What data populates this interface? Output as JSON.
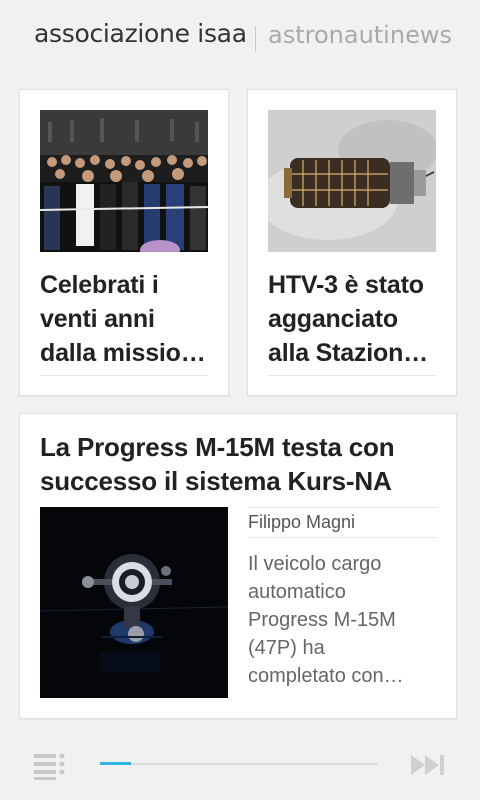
{
  "header": {
    "active_tab": "associazione isaa",
    "inactive_tab": "astronautinews"
  },
  "cards": [
    {
      "title_lines": [
        "Celebrati i",
        "venti anni",
        "dalla missio…"
      ],
      "image": "ceremony-ribbon-cutting-photo"
    },
    {
      "title_lines": [
        "HTV-3 è stato",
        "agganciato",
        "alla Stazione…"
      ],
      "image": "htv3-spacecraft-photo"
    }
  ],
  "feature": {
    "title_lines": [
      "La Progress M-15M testa con",
      "successo il sistema Kurs-NA"
    ],
    "author": "Filippo Magni",
    "summary_lines": [
      "Il veicolo cargo",
      "automatico",
      "Progress M-15M",
      "(47P) ha",
      "completato con…"
    ],
    "image": "progress-spacecraft-night-photo"
  },
  "bottom_bar": {
    "menu_icon": "list-menu-icon",
    "next_icon": "fast-forward-icon",
    "progress": 0.11
  },
  "colors": {
    "accent": "#33b5e5",
    "background": "#f1f1f1",
    "card": "#ffffff"
  }
}
